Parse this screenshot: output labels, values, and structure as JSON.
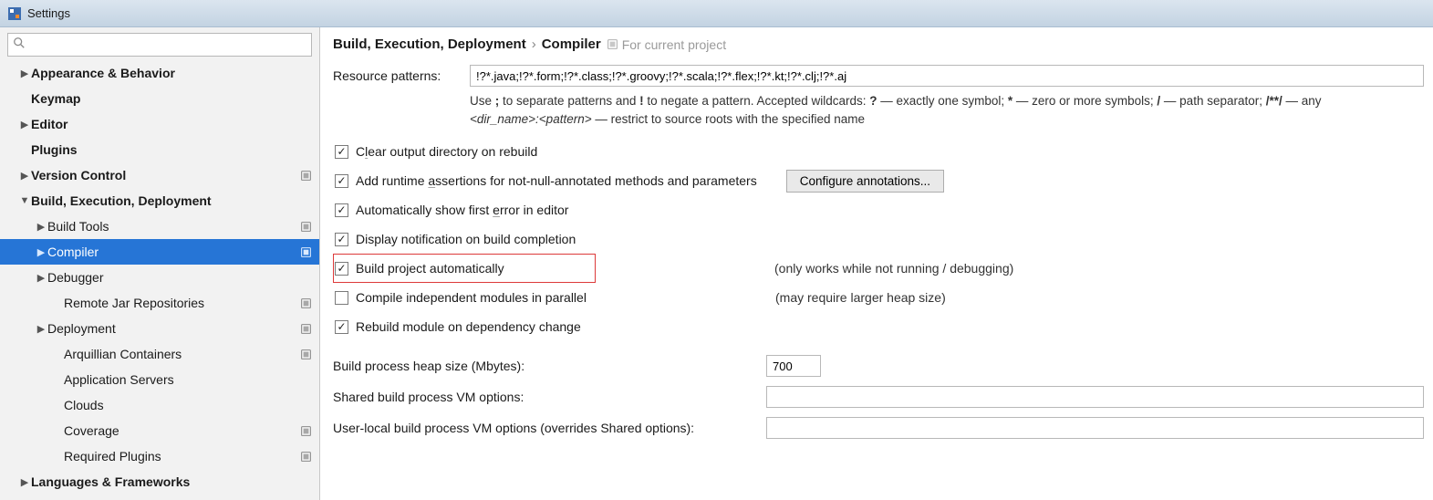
{
  "window": {
    "title": "Settings"
  },
  "search": {
    "placeholder": ""
  },
  "sidebar": {
    "items": [
      {
        "label": "Appearance & Behavior",
        "chevron": "right",
        "bold": true,
        "depth": 0,
        "proj": false
      },
      {
        "label": "Keymap",
        "chevron": "",
        "bold": true,
        "depth": 0,
        "proj": false
      },
      {
        "label": "Editor",
        "chevron": "right",
        "bold": true,
        "depth": 0,
        "proj": false
      },
      {
        "label": "Plugins",
        "chevron": "",
        "bold": true,
        "depth": 0,
        "proj": false
      },
      {
        "label": "Version Control",
        "chevron": "right",
        "bold": true,
        "depth": 0,
        "proj": true
      },
      {
        "label": "Build, Execution, Deployment",
        "chevron": "down",
        "bold": true,
        "depth": 0,
        "proj": false
      },
      {
        "label": "Build Tools",
        "chevron": "right",
        "bold": false,
        "depth": 1,
        "proj": true
      },
      {
        "label": "Compiler",
        "chevron": "right",
        "bold": false,
        "depth": 1,
        "proj": true,
        "selected": true
      },
      {
        "label": "Debugger",
        "chevron": "right",
        "bold": false,
        "depth": 1,
        "proj": false
      },
      {
        "label": "Remote Jar Repositories",
        "chevron": "",
        "bold": false,
        "depth": 2,
        "proj": true
      },
      {
        "label": "Deployment",
        "chevron": "right",
        "bold": false,
        "depth": 1,
        "proj": true
      },
      {
        "label": "Arquillian Containers",
        "chevron": "",
        "bold": false,
        "depth": 2,
        "proj": true
      },
      {
        "label": "Application Servers",
        "chevron": "",
        "bold": false,
        "depth": 2,
        "proj": false
      },
      {
        "label": "Clouds",
        "chevron": "",
        "bold": false,
        "depth": 2,
        "proj": false
      },
      {
        "label": "Coverage",
        "chevron": "",
        "bold": false,
        "depth": 2,
        "proj": true
      },
      {
        "label": "Required Plugins",
        "chevron": "",
        "bold": false,
        "depth": 2,
        "proj": true
      },
      {
        "label": "Languages & Frameworks",
        "chevron": "right",
        "bold": true,
        "depth": 0,
        "proj": false
      }
    ]
  },
  "breadcrumb": {
    "part1": "Build, Execution, Deployment",
    "sep": "›",
    "part2": "Compiler",
    "scope": "For current project"
  },
  "resource": {
    "label": "Resource patterns:",
    "value": "!?*.java;!?*.form;!?*.class;!?*.groovy;!?*.scala;!?*.flex;!?*.kt;!?*.clj;!?*.aj",
    "help1_pre": "Use ",
    "help1_b1": ";",
    "help1_mid": " to separate patterns and ",
    "help1_b2": "!",
    "help1_post": " to negate a pattern. Accepted wildcards: ",
    "help1_b3": "?",
    "help1_q": " — exactly one symbol; ",
    "help1_b4": "*",
    "help1_star": " — zero or more symbols; ",
    "help1_b5": "/",
    "help1_slash": " — path separator; ",
    "help1_b6": "/**/",
    "help1_end": " — any",
    "help2_it": "<dir_name>:<pattern>",
    "help2_post": " — restrict to source roots with the specified name"
  },
  "checks": {
    "clear": {
      "label": "Clear output directory on rebuild",
      "checked": true
    },
    "assertions": {
      "label": "Add runtime assertions for not-null-annotated methods and parameters",
      "checked": true,
      "button": "Configure annotations..."
    },
    "firsterror": {
      "label": "Automatically show first error in editor",
      "checked": true
    },
    "notif": {
      "label": "Display notification on build completion",
      "checked": true
    },
    "auto": {
      "label": "Build project automatically",
      "checked": true,
      "note": "(only works while not running / debugging)"
    },
    "parallel": {
      "label": "Compile independent modules in parallel",
      "checked": false,
      "note": "(may require larger heap size)"
    },
    "rebuild": {
      "label": "Rebuild module on dependency change",
      "checked": true
    }
  },
  "form": {
    "heap": {
      "label": "Build process heap size (Mbytes):",
      "value": "700"
    },
    "shared": {
      "label": "Shared build process VM options:",
      "value": ""
    },
    "local": {
      "label": "User-local build process VM options (overrides Shared options):",
      "value": ""
    }
  }
}
